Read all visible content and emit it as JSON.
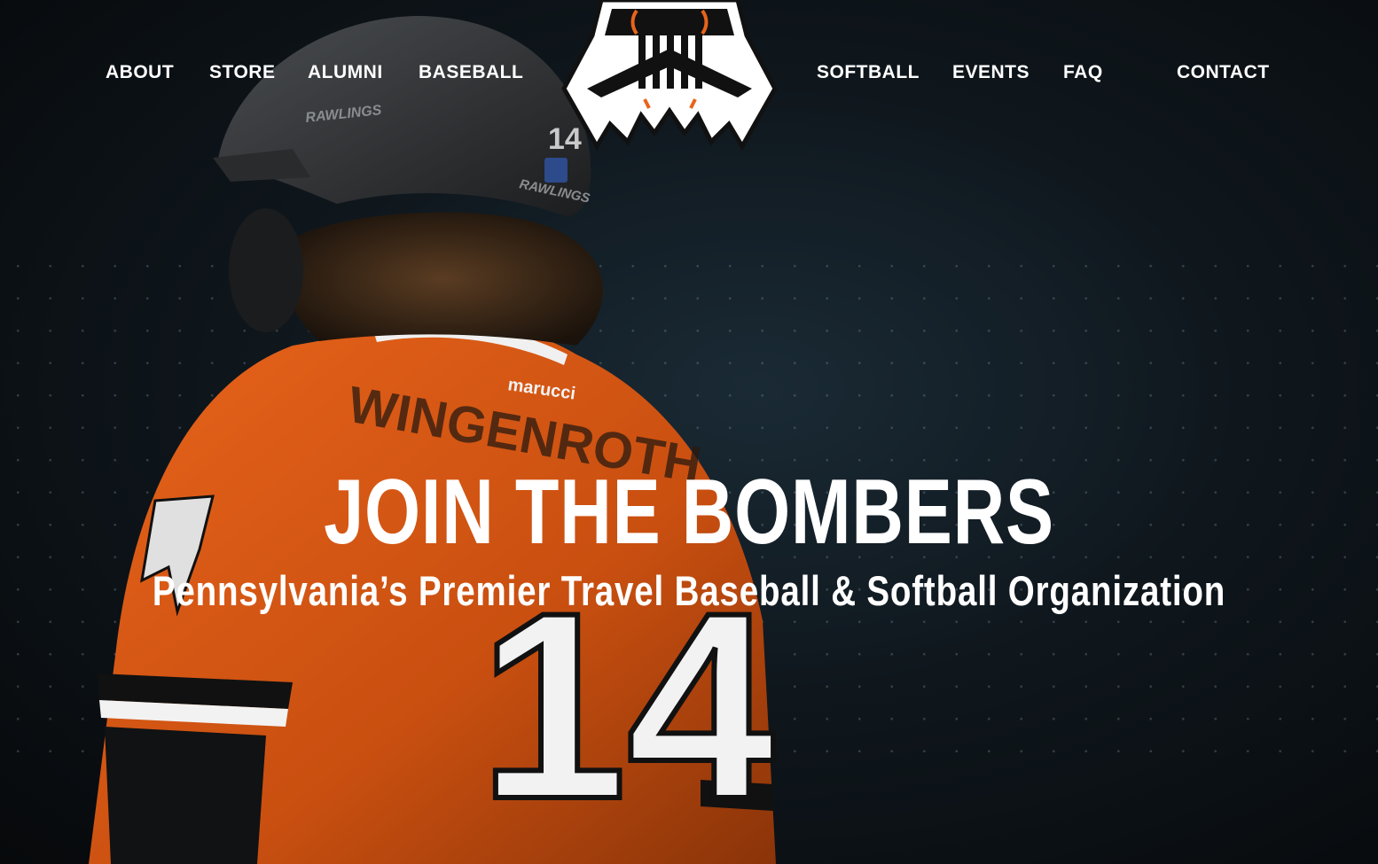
{
  "nav": {
    "left": [
      {
        "label": "ABOUT"
      },
      {
        "label": "STORE"
      },
      {
        "label": "ALUMNI"
      },
      {
        "label": "BASEBALL"
      }
    ],
    "right": [
      {
        "label": "SOFTBALL"
      },
      {
        "label": "EVENTS"
      },
      {
        "label": "FAQ"
      },
      {
        "label": "CONTACT"
      }
    ]
  },
  "hero": {
    "title": "JOIN THE BOMBERS",
    "subtitle": "Pennsylvania’s Premier Travel Baseball & Softball Organization",
    "photo": {
      "helmet_brand": "RAWLINGS",
      "jersey_brand": "marucci",
      "jersey_name": "WINGENROTH",
      "jersey_number": "14"
    }
  },
  "logo": {
    "icon": "bombers-keystone-logo-icon"
  },
  "colors": {
    "accent": "#e8641b",
    "text": "#ffffff",
    "background": "#0c0f12"
  }
}
